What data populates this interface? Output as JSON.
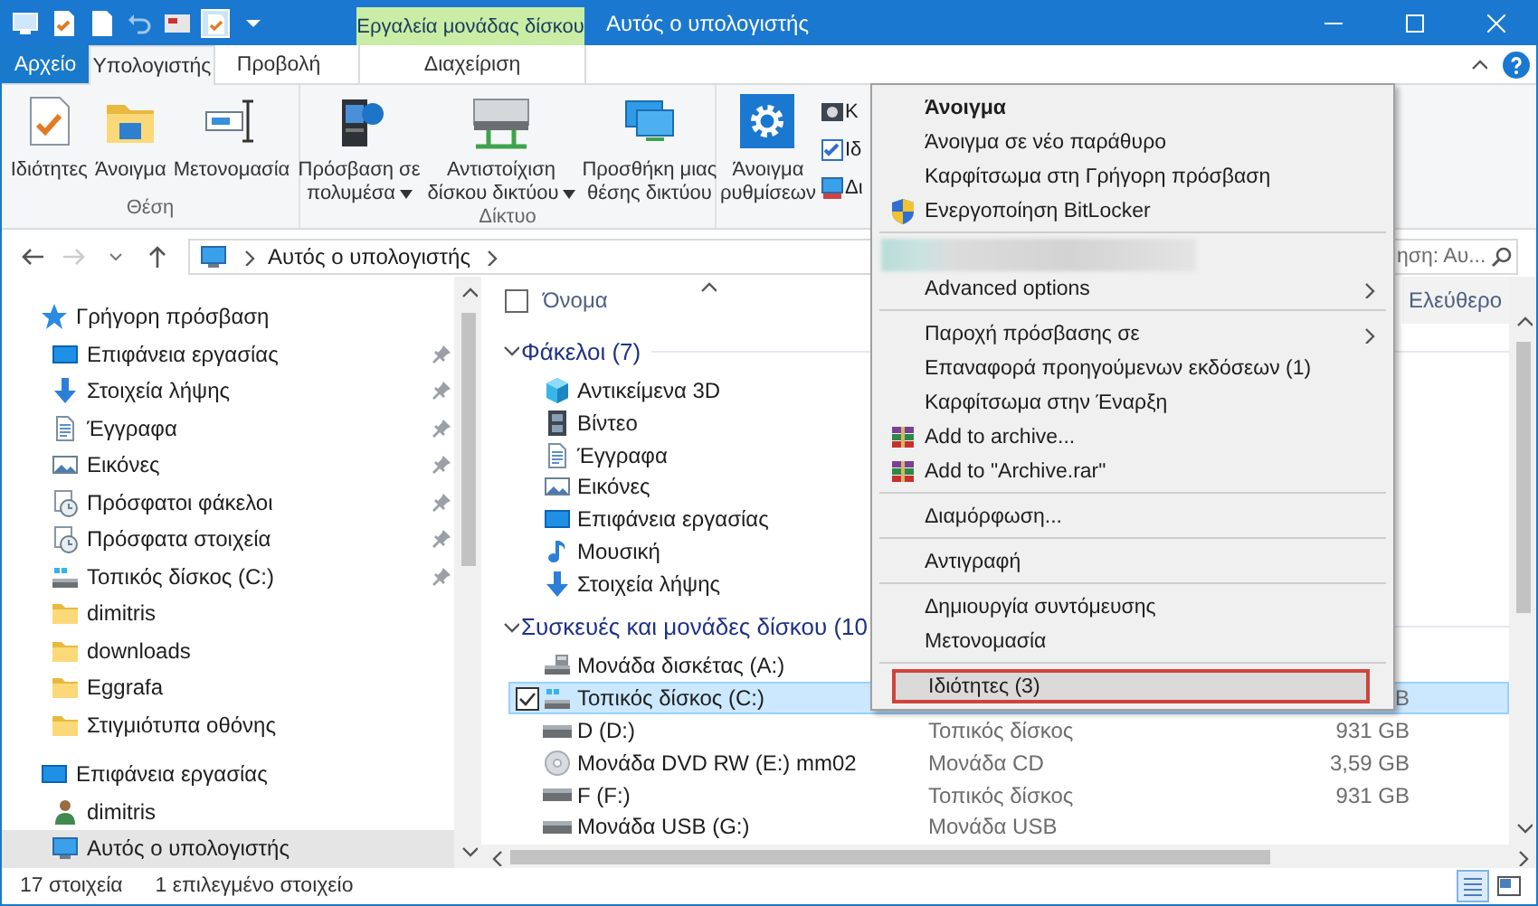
{
  "title_bar": {
    "context_tab": "Εργαλεία μονάδας δίσκου",
    "title": "Αυτός ο υπολογιστής"
  },
  "ribbon_tabs": [
    {
      "label": "Αρχείο",
      "kind": "file",
      "selected": false
    },
    {
      "label": "Υπολογιστής",
      "kind": "tab",
      "selected": true
    },
    {
      "label": "Προβολή",
      "kind": "tab",
      "selected": false
    },
    {
      "label": "Διαχείριση",
      "kind": "context",
      "selected": false
    }
  ],
  "ribbon_groups": [
    {
      "title": "Θέση",
      "buttons": [
        {
          "label": "Ιδιότητες",
          "kind": "properties",
          "dropdown": false
        },
        {
          "label": "Άνοιγμα",
          "kind": "open",
          "dropdown": false
        },
        {
          "label": "Μετονομασία",
          "kind": "rename",
          "dropdown": false
        }
      ]
    },
    {
      "title": "Δίκτυο",
      "buttons": [
        {
          "label": "Πρόσβαση σε πολυμέσα",
          "kind": "media",
          "dropdown": true
        },
        {
          "label": "Αντιστοίχιση δίσκου δικτύου",
          "kind": "mapdrive",
          "dropdown": true
        },
        {
          "label": "Προσθήκη μιας θέσης δικτύου",
          "kind": "netloc",
          "dropdown": false
        }
      ]
    },
    {
      "buttons": [
        {
          "label": "Άνοιγμα ρυθμίσεων",
          "kind": "settings",
          "dropdown": false
        }
      ],
      "small_buttons": [
        {
          "label": "Κ",
          "kind": "camera"
        },
        {
          "label": "Ιδ",
          "kind": "sysprops"
        },
        {
          "label": "Δι",
          "kind": "manage"
        }
      ]
    }
  ],
  "address_bar": {
    "path": [
      "Αυτός ο υπολογιστής"
    ],
    "search_placeholder": "ηση: Αυ..."
  },
  "navigation_pane": {
    "items": [
      {
        "label": "Γρήγορη πρόσβαση",
        "kind": "star",
        "pinned": false,
        "selected": false,
        "children": [
          {
            "label": "Επιφάνεια εργασίας",
            "kind": "desktop",
            "pinned": true,
            "selected": false
          },
          {
            "label": "Στοιχεία λήψης",
            "kind": "download",
            "pinned": true,
            "selected": false
          },
          {
            "label": "Έγγραφα",
            "kind": "document",
            "pinned": true,
            "selected": false
          },
          {
            "label": "Εικόνες",
            "kind": "pictures",
            "pinned": true,
            "selected": false
          },
          {
            "label": "Πρόσφατοι φάκελοι",
            "kind": "recent",
            "pinned": true,
            "selected": false
          },
          {
            "label": "Πρόσφατα στοιχεία",
            "kind": "recent",
            "pinned": true,
            "selected": false
          },
          {
            "label": "Τοπικός δίσκος (C:)",
            "kind": "drive",
            "pinned": true,
            "selected": false
          },
          {
            "label": "dimitris",
            "kind": "folder",
            "pinned": false,
            "selected": false
          },
          {
            "label": "downloads",
            "kind": "folder",
            "pinned": false,
            "selected": false
          },
          {
            "label": "Eggrafa",
            "kind": "folder",
            "pinned": false,
            "selected": false
          },
          {
            "label": "Στιγμιότυπα οθόνης",
            "kind": "folder",
            "pinned": false,
            "selected": false
          }
        ]
      },
      {
        "label": "Επιφάνεια εργασίας",
        "kind": "desktop",
        "pinned": false,
        "selected": false,
        "children": [
          {
            "label": "dimitris",
            "kind": "user",
            "pinned": false,
            "selected": false
          },
          {
            "label": "Αυτός ο υπολογιστής",
            "kind": "computer",
            "pinned": false,
            "selected": true
          }
        ]
      }
    ]
  },
  "file_list": {
    "columns": [
      {
        "label": "Όνομα"
      },
      {
        "label": "Ελεύθερο"
      }
    ],
    "groups": [
      {
        "title": "Φάκελοι (7)",
        "expanded": true,
        "items": [
          {
            "name": "Αντικείμενα 3D",
            "kind": "cube",
            "selected": false
          },
          {
            "name": "Βίντεο",
            "kind": "film",
            "selected": false
          },
          {
            "name": "Έγγραφα",
            "kind": "document",
            "selected": false
          },
          {
            "name": "Εικόνες",
            "kind": "pictures",
            "selected": false
          },
          {
            "name": "Επιφάνεια εργασίας",
            "kind": "desktop",
            "selected": false
          },
          {
            "name": "Μουσική",
            "kind": "music",
            "selected": false
          },
          {
            "name": "Στοιχεία λήψης",
            "kind": "download",
            "selected": false
          }
        ]
      },
      {
        "title": "Συσκευές και μονάδες δίσκου (10",
        "expanded": true,
        "items": [
          {
            "name": "Μονάδα δισκέτας (A:)",
            "kind": "floppy",
            "selected": false
          },
          {
            "name": "Τοπικός δίσκος (C:)",
            "kind": "drive",
            "selected": true,
            "size": "B"
          },
          {
            "name": "D (D:)",
            "kind": "hdd",
            "selected": false,
            "type": "Τοπικός δίσκος",
            "size": "931 GB"
          },
          {
            "name": "Μονάδα DVD RW (E:) mm02",
            "kind": "disc",
            "selected": false,
            "type": "Μονάδα CD",
            "size": "3,59 GB"
          },
          {
            "name": "F (F:)",
            "kind": "hdd",
            "selected": false,
            "type": "Τοπικός δίσκος",
            "size": "931 GB"
          },
          {
            "name": "Μονάδα USB (G:)",
            "kind": "hdd",
            "selected": false,
            "type": "Μονάδα USB"
          }
        ]
      }
    ]
  },
  "status_bar": {
    "count": "17 στοιχεία",
    "selection": "1 επιλεγμένο στοιχείο",
    "views": [
      {
        "kind": "details",
        "selected": true
      },
      {
        "kind": "tiles",
        "selected": false
      }
    ]
  },
  "context_menu": {
    "items": [
      {
        "kind": "item",
        "label": "Άνοιγμα",
        "default": true
      },
      {
        "kind": "item",
        "label": "Άνοιγμα σε νέο παράθυρο"
      },
      {
        "kind": "item",
        "label": "Καρφίτσωμα στη Γρήγορη πρόσβαση"
      },
      {
        "kind": "shield",
        "label": "Ενεργοποίηση BitLocker"
      },
      {
        "kind": "separator"
      },
      {
        "kind": "blurred"
      },
      {
        "kind": "submenu",
        "label": "Advanced options"
      },
      {
        "kind": "separator"
      },
      {
        "kind": "submenu",
        "label": "Παροχή πρόσβασης σε"
      },
      {
        "kind": "item",
        "label": "Επαναφορά προηγούμενων εκδόσεων (1)"
      },
      {
        "kind": "item",
        "label": "Καρφίτσωμα στην Έναρξη"
      },
      {
        "kind": "archive",
        "label": "Add to archive..."
      },
      {
        "kind": "archive",
        "label": "Add to \"Archive.rar\""
      },
      {
        "kind": "separator"
      },
      {
        "kind": "item",
        "label": "Διαμόρφωση..."
      },
      {
        "kind": "separator"
      },
      {
        "kind": "item",
        "label": "Αντιγραφή"
      },
      {
        "kind": "separator"
      },
      {
        "kind": "item",
        "label": "Δημιουργία συντόμευσης"
      },
      {
        "kind": "item",
        "label": "Μετονομασία"
      },
      {
        "kind": "separator"
      },
      {
        "kind": "item",
        "label": "Ιδιότητες (3)",
        "selected": true,
        "outlined": true
      }
    ]
  }
}
